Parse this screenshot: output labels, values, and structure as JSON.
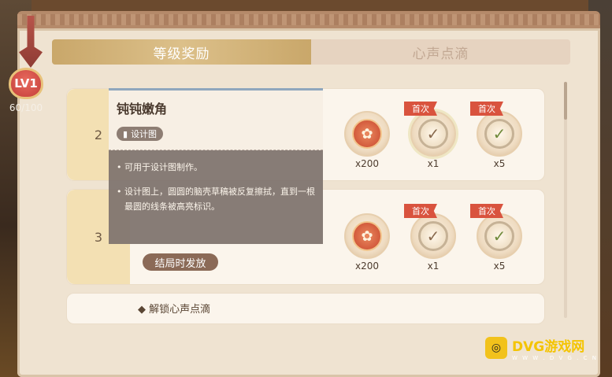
{
  "tabs": [
    {
      "label": "等级奖励",
      "active": true
    },
    {
      "label": "心声点滴",
      "active": false
    }
  ],
  "level": {
    "label": "LV1",
    "progress": "60/100"
  },
  "rows": [
    {
      "number": "2",
      "rewards": [
        {
          "icon": "fox-token-icon",
          "count": "x200",
          "first": false
        },
        {
          "icon": "check-badge-icon",
          "count": "x1",
          "first": true,
          "first_label": "首次"
        },
        {
          "icon": "leaf-badge-icon",
          "count": "x5",
          "first": true,
          "first_label": "首次"
        }
      ]
    },
    {
      "number": "3",
      "end_tag": "结局时发放",
      "rewards": [
        {
          "icon": "fox-token-icon",
          "count": "x200",
          "first": false
        },
        {
          "icon": "check-badge-icon",
          "count": "x1",
          "first": true,
          "first_label": "首次"
        },
        {
          "icon": "leaf-badge-icon",
          "count": "x5",
          "first": true,
          "first_label": "首次"
        }
      ]
    },
    {
      "label": "解锁心声点滴"
    }
  ],
  "tooltip": {
    "title": "钝钝嫩角",
    "type": "设计图",
    "lines": [
      "可用于设计图制作。",
      "设计图上，圆圆的脑壳草稿被反复擦拭，直到一根最圆的线条被高亮标识。"
    ]
  },
  "watermark": {
    "brand": "DVG游戏网",
    "sub": "W W W . D V G . C N"
  },
  "colors": {
    "accent": "#d9533e",
    "tab_active": "#c9a76a",
    "panel": "#efe3d1"
  }
}
